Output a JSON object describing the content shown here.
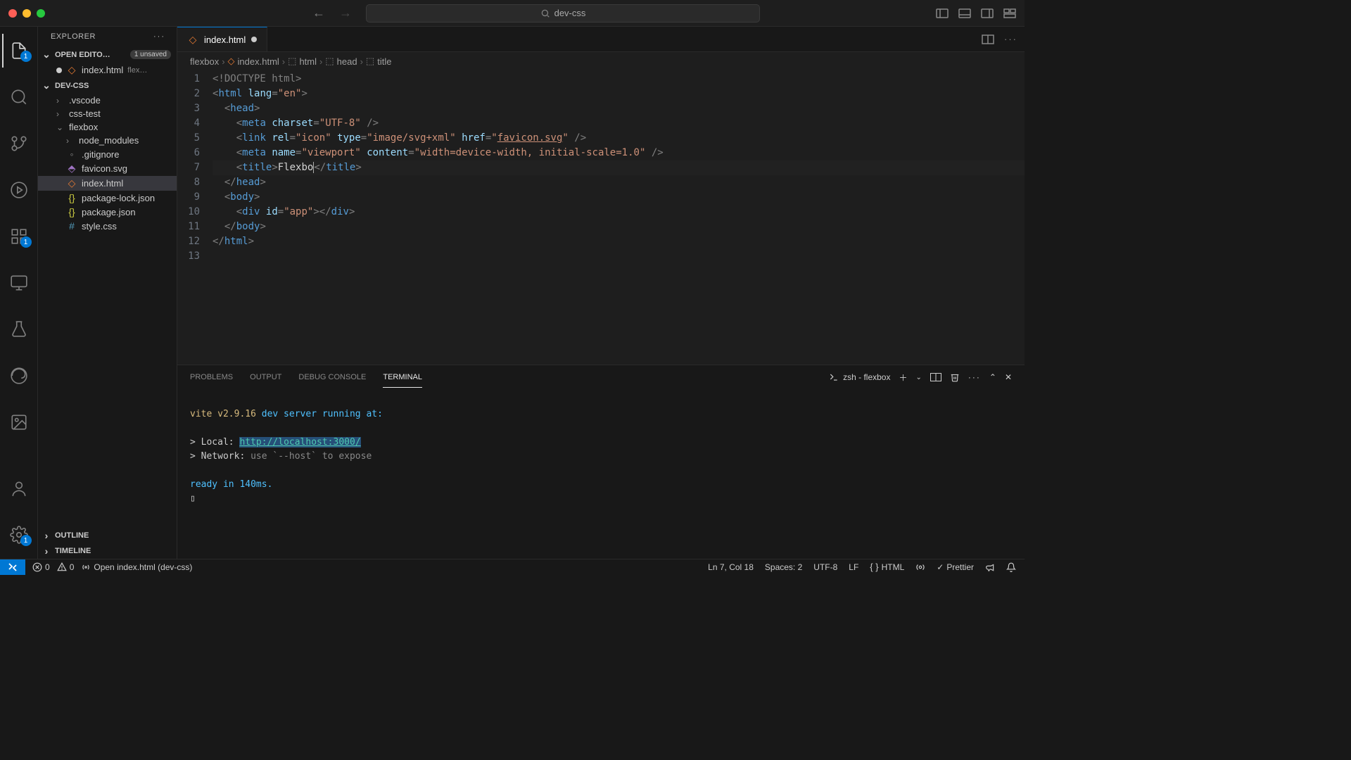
{
  "titlebar": {
    "search_text": "dev-css"
  },
  "sidebar": {
    "title": "EXPLORER",
    "open_editors_label": "OPEN EDITO…",
    "unsaved_badge": "1 unsaved",
    "open_editors": [
      {
        "name": "index.html",
        "dir": "flex…",
        "dirty": true
      }
    ],
    "workspace_label": "DEV-CSS",
    "tree": [
      {
        "kind": "folder",
        "name": ".vscode",
        "open": false,
        "depth": 1
      },
      {
        "kind": "folder",
        "name": "css-test",
        "open": false,
        "depth": 1
      },
      {
        "kind": "folder",
        "name": "flexbox",
        "open": true,
        "depth": 1
      },
      {
        "kind": "folder",
        "name": "node_modules",
        "open": false,
        "depth": 2
      },
      {
        "kind": "file",
        "name": ".gitignore",
        "icon": "gray",
        "depth": 2
      },
      {
        "kind": "file",
        "name": "favicon.svg",
        "icon": "purple",
        "depth": 2
      },
      {
        "kind": "file",
        "name": "index.html",
        "icon": "orange",
        "depth": 2,
        "selected": true
      },
      {
        "kind": "file",
        "name": "package-lock.json",
        "icon": "yellow",
        "depth": 2
      },
      {
        "kind": "file",
        "name": "package.json",
        "icon": "yellow",
        "depth": 2
      },
      {
        "kind": "file",
        "name": "style.css",
        "icon": "blue",
        "depth": 2
      }
    ],
    "outline_label": "OUTLINE",
    "timeline_label": "TIMELINE"
  },
  "activity_badges": {
    "explorer": "1",
    "extensions": "1",
    "settings": "1"
  },
  "tab": {
    "filename": "index.html",
    "dirty": true
  },
  "breadcrumb": [
    "flexbox",
    "index.html",
    "html",
    "head",
    "title"
  ],
  "code": {
    "lines": [
      {
        "n": 1,
        "tokens": [
          [
            "bracket",
            "<!"
          ],
          [
            "doctype",
            "DOCTYPE html"
          ],
          [
            "bracket",
            ">"
          ]
        ]
      },
      {
        "n": 2,
        "tokens": [
          [
            "bracket",
            "<"
          ],
          [
            "tag",
            "html"
          ],
          [
            "txt",
            " "
          ],
          [
            "attr-name",
            "lang"
          ],
          [
            "bracket",
            "="
          ],
          [
            "attr-val",
            "\"en\""
          ],
          [
            "bracket",
            ">"
          ]
        ]
      },
      {
        "n": 3,
        "tokens": [
          [
            "txt",
            "  "
          ],
          [
            "bracket",
            "<"
          ],
          [
            "tag",
            "head"
          ],
          [
            "bracket",
            ">"
          ]
        ]
      },
      {
        "n": 4,
        "tokens": [
          [
            "txt",
            "    "
          ],
          [
            "bracket",
            "<"
          ],
          [
            "tag",
            "meta"
          ],
          [
            "txt",
            " "
          ],
          [
            "attr-name",
            "charset"
          ],
          [
            "bracket",
            "="
          ],
          [
            "attr-val",
            "\"UTF-8\""
          ],
          [
            "txt",
            " "
          ],
          [
            "bracket",
            "/>"
          ]
        ]
      },
      {
        "n": 5,
        "tokens": [
          [
            "txt",
            "    "
          ],
          [
            "bracket",
            "<"
          ],
          [
            "tag",
            "link"
          ],
          [
            "txt",
            " "
          ],
          [
            "attr-name",
            "rel"
          ],
          [
            "bracket",
            "="
          ],
          [
            "attr-val",
            "\"icon\""
          ],
          [
            "txt",
            " "
          ],
          [
            "attr-name",
            "type"
          ],
          [
            "bracket",
            "="
          ],
          [
            "attr-val",
            "\"image/svg+xml\""
          ],
          [
            "txt",
            " "
          ],
          [
            "attr-name",
            "href"
          ],
          [
            "bracket",
            "="
          ],
          [
            "attr-val",
            "\""
          ],
          [
            "link",
            "favicon.svg"
          ],
          [
            "attr-val",
            "\""
          ],
          [
            "txt",
            " "
          ],
          [
            "bracket",
            "/>"
          ]
        ]
      },
      {
        "n": 6,
        "tokens": [
          [
            "txt",
            "    "
          ],
          [
            "bracket",
            "<"
          ],
          [
            "tag",
            "meta"
          ],
          [
            "txt",
            " "
          ],
          [
            "attr-name",
            "name"
          ],
          [
            "bracket",
            "="
          ],
          [
            "attr-val",
            "\"viewport\""
          ],
          [
            "txt",
            " "
          ],
          [
            "attr-name",
            "content"
          ],
          [
            "bracket",
            "="
          ],
          [
            "attr-val",
            "\"width=device-width, initial-scale=1.0\""
          ],
          [
            "txt",
            " "
          ],
          [
            "bracket",
            "/>"
          ]
        ]
      },
      {
        "n": 7,
        "hl": true,
        "tokens": [
          [
            "txt",
            "    "
          ],
          [
            "bracket",
            "<"
          ],
          [
            "tag",
            "title"
          ],
          [
            "bracket",
            ">"
          ],
          [
            "txt",
            "Flexbo"
          ],
          [
            "cursor",
            ""
          ],
          [
            "bracket",
            "</"
          ],
          [
            "tag",
            "title"
          ],
          [
            "bracket",
            ">"
          ]
        ]
      },
      {
        "n": 8,
        "tokens": [
          [
            "txt",
            "  "
          ],
          [
            "bracket",
            "</"
          ],
          [
            "tag",
            "head"
          ],
          [
            "bracket",
            ">"
          ]
        ]
      },
      {
        "n": 9,
        "tokens": [
          [
            "txt",
            "  "
          ],
          [
            "bracket",
            "<"
          ],
          [
            "tag",
            "body"
          ],
          [
            "bracket",
            ">"
          ]
        ]
      },
      {
        "n": 10,
        "tokens": [
          [
            "txt",
            "    "
          ],
          [
            "bracket",
            "<"
          ],
          [
            "tag",
            "div"
          ],
          [
            "txt",
            " "
          ],
          [
            "attr-name",
            "id"
          ],
          [
            "bracket",
            "="
          ],
          [
            "attr-val",
            "\"app\""
          ],
          [
            "bracket",
            "></"
          ],
          [
            "tag",
            "div"
          ],
          [
            "bracket",
            ">"
          ]
        ]
      },
      {
        "n": 11,
        "tokens": [
          [
            "txt",
            "  "
          ],
          [
            "bracket",
            "</"
          ],
          [
            "tag",
            "body"
          ],
          [
            "bracket",
            ">"
          ]
        ]
      },
      {
        "n": 12,
        "tokens": [
          [
            "bracket",
            "</"
          ],
          [
            "tag",
            "html"
          ],
          [
            "bracket",
            ">"
          ]
        ]
      },
      {
        "n": 13,
        "tokens": []
      }
    ]
  },
  "panel": {
    "tabs": [
      "PROBLEMS",
      "OUTPUT",
      "DEBUG CONSOLE",
      "TERMINAL"
    ],
    "active_tab": 3,
    "shell_label": "zsh - flexbox",
    "terminal_lines": [
      {
        "segments": [
          [
            "txt",
            ""
          ]
        ]
      },
      {
        "segments": [
          [
            "yellow",
            "vite v2.9.16"
          ],
          [
            "blue",
            " dev server running at:"
          ]
        ]
      },
      {
        "segments": [
          [
            "txt",
            ""
          ]
        ]
      },
      {
        "segments": [
          [
            "txt",
            "> Local:   "
          ],
          [
            "cyan",
            "http://localhost:3000/"
          ]
        ]
      },
      {
        "segments": [
          [
            "txt",
            "> Network: "
          ],
          [
            "dim",
            "use `--host` to expose"
          ]
        ]
      },
      {
        "segments": [
          [
            "txt",
            ""
          ]
        ]
      },
      {
        "segments": [
          [
            "blue",
            "ready in 140ms."
          ]
        ]
      }
    ]
  },
  "status": {
    "errors": "0",
    "warnings": "0",
    "task": "Open index.html (dev-css)",
    "cursor": "Ln 7, Col 18",
    "spaces": "Spaces: 2",
    "encoding": "UTF-8",
    "eol": "LF",
    "lang": "HTML",
    "prettier": "Prettier"
  }
}
